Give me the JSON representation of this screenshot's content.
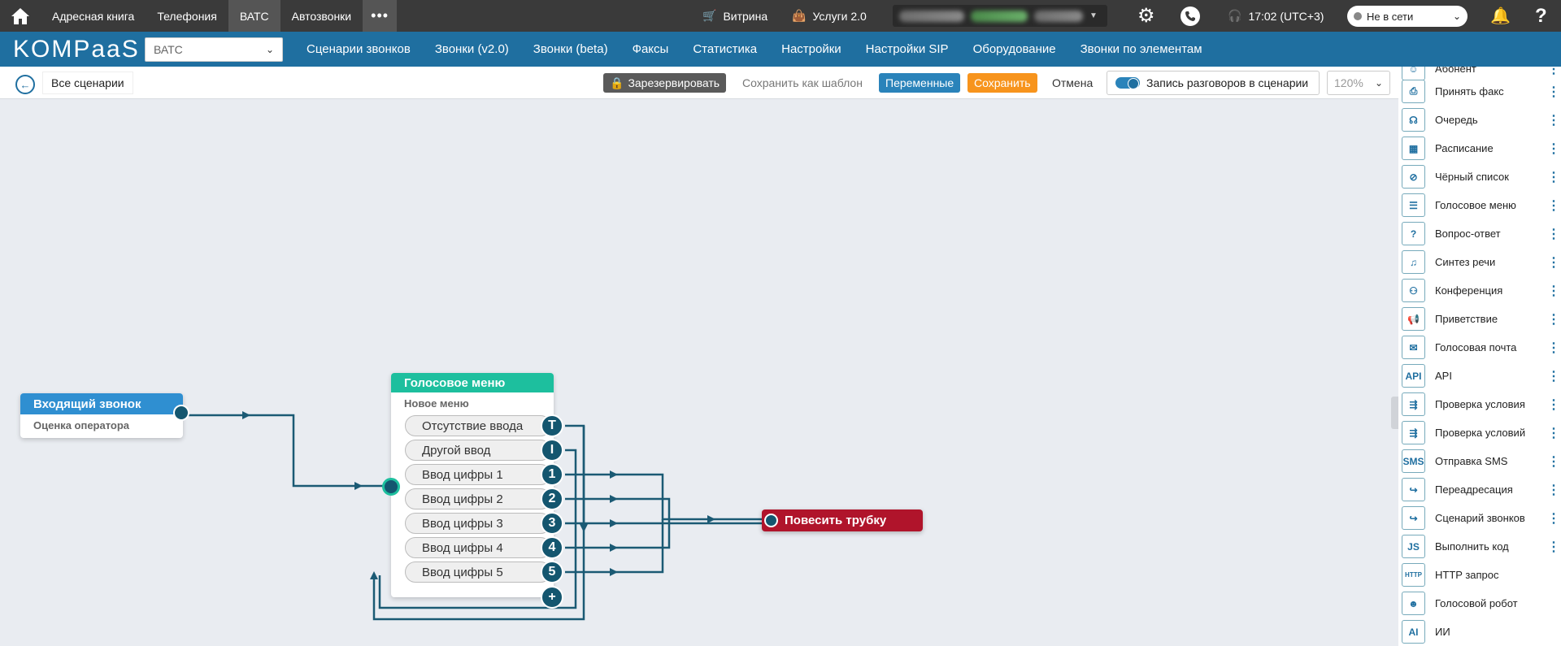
{
  "topbar": {
    "links": [
      "Адресная книга",
      "Телефония",
      "ВАТС",
      "Автозвонки"
    ],
    "active_link": "ВАТС",
    "showcase": "Витрина",
    "services": "Услуги 2.0",
    "time": "17:02 (UTC+3)",
    "status": "Не в сети",
    "help": "?"
  },
  "navbar": {
    "logo": "KOMPaaS",
    "pbx_select": "ВАТС",
    "links": [
      "Сценарии звонков",
      "Звонки (v2.0)",
      "Звонки (beta)",
      "Факсы",
      "Статистика",
      "Настройки",
      "Настройки SIP",
      "Оборудование",
      "Звонки по элементам"
    ]
  },
  "toolbar": {
    "all_scenarios": "Все сценарии",
    "reserve": "Зарезервировать",
    "save_template": "Сохранить как шаблон",
    "variables": "Переменные",
    "save": "Сохранить",
    "cancel": "Отмена",
    "record_label": "Запись разговоров в сценарии",
    "zoom": "120%"
  },
  "canvas": {
    "incoming": {
      "title": "Входящий звонок",
      "subtitle": "Оценка оператора"
    },
    "ivr": {
      "title": "Голосовое меню",
      "subtitle": "Новое меню",
      "options": [
        {
          "label": "Отсутствие ввода",
          "port": "T"
        },
        {
          "label": "Другой ввод",
          "port": "I"
        },
        {
          "label": "Ввод цифры 1",
          "port": "1"
        },
        {
          "label": "Ввод цифры 2",
          "port": "2"
        },
        {
          "label": "Ввод цифры 3",
          "port": "3"
        },
        {
          "label": "Ввод цифры 4",
          "port": "4"
        },
        {
          "label": "Ввод цифры 5",
          "port": "5"
        }
      ],
      "add_port": "+"
    },
    "hangup": {
      "title": "Повесить трубку"
    }
  },
  "panel": {
    "items": [
      {
        "label": "Абонент",
        "icon": "subscriber-icon",
        "menu": true
      },
      {
        "label": "Принять факс",
        "icon": "fax-icon",
        "menu": true
      },
      {
        "label": "Очередь",
        "icon": "queue-icon",
        "menu": true
      },
      {
        "label": "Расписание",
        "icon": "calendar-icon",
        "menu": true
      },
      {
        "label": "Чёрный список",
        "icon": "blacklist-icon",
        "menu": true
      },
      {
        "label": "Голосовое меню",
        "icon": "ivr-icon",
        "menu": true
      },
      {
        "label": "Вопрос-ответ",
        "icon": "qa-icon",
        "menu": true
      },
      {
        "label": "Синтез речи",
        "icon": "tts-icon",
        "menu": true
      },
      {
        "label": "Конференция",
        "icon": "conference-icon",
        "menu": true
      },
      {
        "label": "Приветствие",
        "icon": "greeting-icon",
        "menu": true
      },
      {
        "label": "Голосовая почта",
        "icon": "voicemail-icon",
        "menu": true
      },
      {
        "label": "API",
        "icon": "api-icon",
        "menu": true
      },
      {
        "label": "Проверка условия",
        "icon": "condition-icon",
        "menu": true
      },
      {
        "label": "Проверка условий",
        "icon": "conditions-icon",
        "menu": true
      },
      {
        "label": "Отправка SMS",
        "icon": "sms-icon",
        "menu": true
      },
      {
        "label": "Переадресация",
        "icon": "forward-icon",
        "menu": true
      },
      {
        "label": "Сценарий звонков",
        "icon": "scenario-icon",
        "menu": true
      },
      {
        "label": "Выполнить код",
        "icon": "js-icon",
        "menu": true
      },
      {
        "label": "HTTP запрос",
        "icon": "http-icon",
        "menu": false
      },
      {
        "label": "Голосовой робот",
        "icon": "robot-icon",
        "menu": false
      },
      {
        "label": "ИИ",
        "icon": "ai-icon",
        "menu": false
      }
    ],
    "icon_glyphs": [
      "☺",
      "⎙",
      "☊",
      "▦",
      "⊘",
      "☰",
      "?",
      "♫",
      "⚇",
      "📢",
      "✉",
      "API",
      "⇶",
      "⇶",
      "SMS",
      "↪",
      "↪",
      "JS",
      "HTTP",
      "☻",
      "AI"
    ]
  },
  "colors": {
    "nav_blue": "#1f6fa0",
    "ivr_green": "#1dbf9e",
    "incoming_blue": "#2f8fd1",
    "hangup_red": "#b0142b",
    "wire": "#1b5a74",
    "save_orange": "#f7941d"
  }
}
